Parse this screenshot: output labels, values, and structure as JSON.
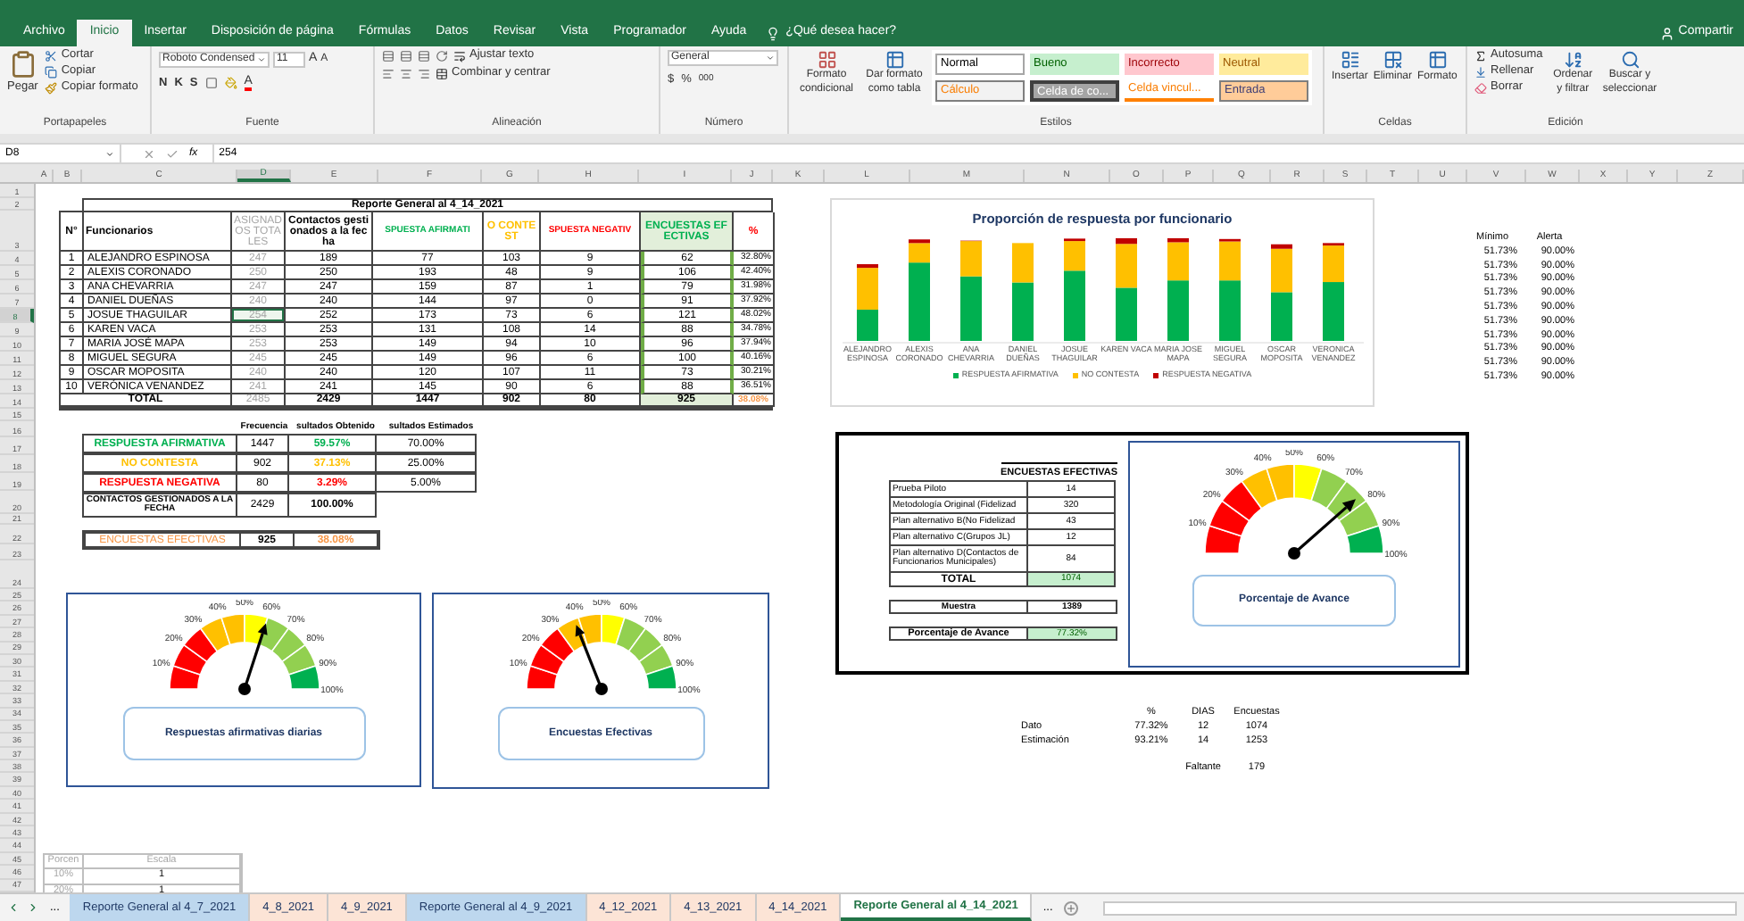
{
  "ribbon": {
    "tabs": [
      {
        "label": "Archivo",
        "selected": false
      },
      {
        "label": "Inicio",
        "selected": true
      },
      {
        "label": "Insertar",
        "selected": false
      },
      {
        "label": "Disposición de página",
        "selected": false
      },
      {
        "label": "Fórmulas",
        "selected": false
      },
      {
        "label": "Datos",
        "selected": false
      },
      {
        "label": "Revisar",
        "selected": false
      },
      {
        "label": "Vista",
        "selected": false
      },
      {
        "label": "Programador",
        "selected": false
      },
      {
        "label": "Ayuda",
        "selected": false
      }
    ],
    "tell_me": "¿Qué desea hacer?",
    "share": "Compartir",
    "clipboard": {
      "paste": "Pegar",
      "cut": "Cortar",
      "copy": "Copiar",
      "format_painter": "Copiar formato",
      "label": "Portapapeles"
    },
    "font": {
      "name": "Roboto Condensed",
      "size": "11",
      "grow": "A",
      "shrink": "A",
      "styles": [
        "N",
        "K",
        "S"
      ],
      "font_color_label": "A",
      "label": "Fuente"
    },
    "alignment": {
      "wrap": "Ajustar texto",
      "merge": "Combinar y centrar",
      "label": "Alineación"
    },
    "number": {
      "format": "General",
      "currency": "$",
      "percent": "%",
      "thousands": "000",
      "label": "Número"
    },
    "styles": {
      "conditional": "Formato condicional",
      "as_table": "Dar formato como tabla",
      "label": "Estilos",
      "gallery": [
        {
          "label": "Normal",
          "kind": "normal"
        },
        {
          "label": "Bueno",
          "kind": "good"
        },
        {
          "label": "Incorrecto",
          "kind": "bad"
        },
        {
          "label": "Neutral",
          "kind": "neutral"
        },
        {
          "label": "Cálculo",
          "kind": "calc"
        },
        {
          "label": "Celda de co...",
          "kind": "check"
        },
        {
          "label": "Celda vincul...",
          "kind": "linked"
        },
        {
          "label": "Entrada",
          "kind": "input"
        }
      ]
    },
    "cells": {
      "buttons": [
        "Insertar",
        "Eliminar",
        "Formato"
      ],
      "label": "Celdas"
    },
    "editing": {
      "autosum": "Autosuma",
      "fill": "Rellenar",
      "clear": "Borrar",
      "sort": "Ordenar y filtrar",
      "find": "Buscar y seleccionar",
      "label": "Edición"
    }
  },
  "formula_bar": {
    "name_box": "D8",
    "fx": "fx",
    "formula": "254"
  },
  "columns": [
    {
      "label": "A",
      "selected": false
    },
    {
      "label": "B",
      "selected": false
    },
    {
      "label": "C",
      "selected": false
    },
    {
      "label": "D",
      "selected": true
    },
    {
      "label": "E",
      "selected": false
    },
    {
      "label": "F",
      "selected": false
    },
    {
      "label": "G",
      "selected": false
    },
    {
      "label": "H",
      "selected": false
    },
    {
      "label": "I",
      "selected": false
    },
    {
      "label": "J",
      "selected": false
    },
    {
      "label": "K",
      "selected": false
    },
    {
      "label": "L",
      "selected": false
    },
    {
      "label": "M",
      "selected": false
    },
    {
      "label": "N",
      "selected": false
    },
    {
      "label": "O",
      "selected": false
    },
    {
      "label": "P",
      "selected": false
    },
    {
      "label": "Q",
      "selected": false
    },
    {
      "label": "R",
      "selected": false
    },
    {
      "label": "S",
      "selected": false
    },
    {
      "label": "T",
      "selected": false
    },
    {
      "label": "U",
      "selected": false
    },
    {
      "label": "V",
      "selected": false
    },
    {
      "label": "W",
      "selected": false
    },
    {
      "label": "X",
      "selected": false
    },
    {
      "label": "Y",
      "selected": false
    },
    {
      "label": "Z",
      "selected": false
    }
  ],
  "rows": [
    {
      "label": "1",
      "selected": false
    },
    {
      "label": "2",
      "selected": false
    },
    {
      "label": "3",
      "selected": false
    },
    {
      "label": "4",
      "selected": false
    },
    {
      "label": "5",
      "selected": false
    },
    {
      "label": "6",
      "selected": false
    },
    {
      "label": "7",
      "selected": false
    },
    {
      "label": "8",
      "selected": true
    },
    {
      "label": "9",
      "selected": false
    },
    {
      "label": "10",
      "selected": false
    },
    {
      "label": "11",
      "selected": false
    },
    {
      "label": "12",
      "selected": false
    },
    {
      "label": "13",
      "selected": false
    },
    {
      "label": "14",
      "selected": false
    },
    {
      "label": "15",
      "selected": false
    },
    {
      "label": "16",
      "selected": false
    },
    {
      "label": "17",
      "selected": false
    },
    {
      "label": "18",
      "selected": false
    },
    {
      "label": "19",
      "selected": false
    },
    {
      "label": "20",
      "selected": false
    },
    {
      "label": "21",
      "selected": false
    },
    {
      "label": "22",
      "selected": false
    },
    {
      "label": "23",
      "selected": false
    },
    {
      "label": "24",
      "selected": false
    },
    {
      "label": "25",
      "selected": false
    },
    {
      "label": "26",
      "selected": false
    },
    {
      "label": "27",
      "selected": false
    },
    {
      "label": "28",
      "selected": false
    },
    {
      "label": "29",
      "selected": false
    },
    {
      "label": "30",
      "selected": false
    },
    {
      "label": "31",
      "selected": false
    },
    {
      "label": "32",
      "selected": false
    },
    {
      "label": "33",
      "selected": false
    },
    {
      "label": "34",
      "selected": false
    },
    {
      "label": "35",
      "selected": false
    },
    {
      "label": "36",
      "selected": false
    },
    {
      "label": "37",
      "selected": false
    },
    {
      "label": "38",
      "selected": false
    },
    {
      "label": "39",
      "selected": false
    },
    {
      "label": "40",
      "selected": false
    },
    {
      "label": "41",
      "selected": false
    },
    {
      "label": "42",
      "selected": false
    },
    {
      "label": "43",
      "selected": false
    },
    {
      "label": "44",
      "selected": false
    },
    {
      "label": "45",
      "selected": false
    },
    {
      "label": "46",
      "selected": false
    },
    {
      "label": "47",
      "selected": false
    }
  ],
  "report": {
    "title": "Reporte General al 4_14_2021",
    "headers": [
      {
        "label": "N°",
        "kind": "plain"
      },
      {
        "label": "Funcionarios",
        "kind": "plain"
      },
      {
        "label": "ASIGNADOS TOTALES",
        "kind": "assigned"
      },
      {
        "label": "Contactos gestionados a la fecha",
        "kind": "plain"
      },
      {
        "label": "SPUESTA AFIRMATI",
        "kind": "affirmative"
      },
      {
        "label": "O CONTEST",
        "kind": "no_answer"
      },
      {
        "label": "SPUESTA NEGATIV",
        "kind": "negative"
      },
      {
        "label": "ENCUESTAS EFECTIVAS",
        "kind": "effective"
      },
      {
        "label": "%",
        "kind": "pct"
      }
    ],
    "rows": [
      {
        "n": "1",
        "name": "ALEJANDRO ESPINOSA",
        "assigned": "247",
        "contacts": "189",
        "yes": "77",
        "no_answer": "103",
        "no": "9",
        "effective": "62",
        "pct": "32.80%",
        "active": false
      },
      {
        "n": "2",
        "name": "ALEXIS CORONADO",
        "assigned": "250",
        "contacts": "250",
        "yes": "193",
        "no_answer": "48",
        "no": "9",
        "effective": "106",
        "pct": "42.40%",
        "active": false
      },
      {
        "n": "3",
        "name": "ANA CHEVARRIA",
        "assigned": "247",
        "contacts": "247",
        "yes": "159",
        "no_answer": "87",
        "no": "1",
        "effective": "79",
        "pct": "31.98%",
        "active": false
      },
      {
        "n": "4",
        "name": "DANIEL DUEÑAS",
        "assigned": "240",
        "contacts": "240",
        "yes": "144",
        "no_answer": "97",
        "no": "0",
        "effective": "91",
        "pct": "37.92%",
        "active": false
      },
      {
        "n": "5",
        "name": "JOSUE THAGUILAR",
        "assigned": "254",
        "contacts": "252",
        "yes": "173",
        "no_answer": "73",
        "no": "6",
        "effective": "121",
        "pct": "48.02%",
        "active": true
      },
      {
        "n": "6",
        "name": "KAREN VACA",
        "assigned": "253",
        "contacts": "253",
        "yes": "131",
        "no_answer": "108",
        "no": "14",
        "effective": "88",
        "pct": "34.78%",
        "active": false
      },
      {
        "n": "7",
        "name": "MARIA JOSÉ MAPA",
        "assigned": "253",
        "contacts": "253",
        "yes": "149",
        "no_answer": "94",
        "no": "10",
        "effective": "96",
        "pct": "37.94%",
        "active": false
      },
      {
        "n": "8",
        "name": "MIGUEL SEGURA",
        "assigned": "245",
        "contacts": "245",
        "yes": "149",
        "no_answer": "96",
        "no": "6",
        "effective": "100",
        "pct": "40.16%",
        "active": false
      },
      {
        "n": "9",
        "name": "OSCAR MOPOSITA",
        "assigned": "240",
        "contacts": "240",
        "yes": "120",
        "no_answer": "107",
        "no": "11",
        "effective": "73",
        "pct": "30.21%",
        "active": false
      },
      {
        "n": "10",
        "name": "VERÓNICA VENANDEZ",
        "assigned": "241",
        "contacts": "241",
        "yes": "145",
        "no_answer": "90",
        "no": "6",
        "effective": "88",
        "pct": "36.51%",
        "active": false
      }
    ],
    "total": {
      "label": "TOTAL",
      "assigned": "2485",
      "contacts": "2429",
      "yes": "1447",
      "no_answer": "902",
      "no": "80",
      "effective": "925",
      "pct": "38.08%"
    }
  },
  "chart": {
    "title": "Proporción de respuesta por funcionario",
    "categories": [
      "ALEJANDRO ESPINOSA",
      "ALEXIS CORONADO",
      "ANA CHEVARRIA",
      "DANIEL DUEÑAS",
      "JOSUE THAGUILAR",
      "KAREN VACA",
      "MARIA JOSE MAPA",
      "MIGUEL SEGURA",
      "OSCAR MOPOSITA",
      "VERONICA VENANDEZ"
    ],
    "legend": [
      {
        "label": "RESPUESTA AFIRMATIVA",
        "color": "#00b050"
      },
      {
        "label": "NO CONTESTA",
        "color": "#ffc000"
      },
      {
        "label": "RESPUESTA NEGATIVA",
        "color": "#c00000"
      }
    ]
  },
  "thresholds": {
    "headers": [
      "Mínimo",
      "Alerta"
    ],
    "rows": [
      [
        "51.73%",
        "90.00%"
      ],
      [
        "51.73%",
        "90.00%"
      ],
      [
        "51.73%",
        "90.00%"
      ],
      [
        "51.73%",
        "90.00%"
      ],
      [
        "51.73%",
        "90.00%"
      ],
      [
        "51.73%",
        "90.00%"
      ],
      [
        "51.73%",
        "90.00%"
      ],
      [
        "51.73%",
        "90.00%"
      ],
      [
        "51.73%",
        "90.00%"
      ],
      [
        "51.73%",
        "90.00%"
      ]
    ]
  },
  "frequency": {
    "headers": [
      "Frecuencia",
      "sultados Obtenido",
      "sultados Estimados"
    ],
    "rows": [
      {
        "label": "RESPUESTA AFIRMATIVA",
        "kind": "affirmative",
        "count": "1447",
        "obtained": "59.57%",
        "estimated": "70.00%"
      },
      {
        "label": "NO CONTESTA",
        "kind": "no_answer",
        "count": "902",
        "obtained": "37.13%",
        "estimated": "25.00%"
      },
      {
        "label": "RESPUESTA NEGATIVA",
        "kind": "negative",
        "count": "80",
        "obtained": "3.29%",
        "estimated": "5.00%"
      },
      {
        "label": "CONTACTOS GESTIONADOS A LA FECHA",
        "kind": "contacts",
        "count": "2429",
        "obtained": "100.00%"
      }
    ],
    "effective": {
      "label": "ENCUESTAS EFECTIVAS",
      "count": "925",
      "obtained": "38.08%"
    }
  },
  "gauges": [
    {
      "title": "Respuestas afirmativas diarias",
      "ticks": [
        "10%",
        "20%",
        "30%",
        "40%",
        "50%",
        "60%",
        "70%",
        "80%",
        "90%",
        "100%"
      ]
    },
    {
      "title": "Encuestas Efectivas",
      "ticks": [
        "10%",
        "20%",
        "30%",
        "40%",
        "50%",
        "60%",
        "70%",
        "80%",
        "90%",
        "100%"
      ]
    },
    {
      "title": "Porcentaje de Avance",
      "ticks": [
        "10%",
        "20%",
        "30%",
        "40%",
        "50%",
        "60%",
        "70%",
        "80%",
        "90%",
        "100%"
      ]
    }
  ],
  "progress": {
    "title": "ENCUESTAS EFECTIVAS",
    "rows": [
      {
        "label": "Prueba Piloto",
        "value": "14"
      },
      {
        "label": "Metodología Original (Fidelizad",
        "value": "320"
      },
      {
        "label": "Plan alternativo B(No Fidelizad",
        "value": "43"
      },
      {
        "label": "Plan alternativo C(Grupos JL)",
        "value": "12"
      },
      {
        "label": "Plan alternativo D(Contactos de Funcionarios Municipales)",
        "value": "84"
      }
    ],
    "total": {
      "label": "TOTAL",
      "value": "1074"
    },
    "sample": {
      "label": "Muestra",
      "value": "1389"
    },
    "advance": {
      "label": "Porcentaje de Avance",
      "value": "77.32%"
    }
  },
  "estimate": {
    "headers": [
      "%",
      "DIAS",
      "Encuestas"
    ],
    "rows": [
      [
        "Dato",
        "77.32%",
        "12",
        "1074"
      ],
      [
        "Estimación",
        "93.21%",
        "14",
        "1253"
      ]
    ],
    "missing": {
      "label": "Faltante",
      "value": "179"
    }
  },
  "scale": {
    "headers": [
      "Porcen",
      "Escala"
    ],
    "rows": [
      [
        "10%",
        "1"
      ],
      [
        "20%",
        "1"
      ]
    ]
  },
  "sheet_tabs": {
    "more": "...",
    "more_right": "...",
    "tabs": [
      {
        "label": "Reporte General al 4_7_2021",
        "color": "#bdd7ee",
        "selected": false
      },
      {
        "label": "4_8_2021",
        "color": "#fce4d6",
        "selected": false
      },
      {
        "label": "4_9_2021",
        "color": "#fce4d6",
        "selected": false
      },
      {
        "label": "Reporte General al 4_9_2021",
        "color": "#bdd7ee",
        "selected": false
      },
      {
        "label": "4_12_2021",
        "color": "#fce4d6",
        "selected": false
      },
      {
        "label": "4_13_2021",
        "color": "#fce4d6",
        "selected": false
      },
      {
        "label": "4_14_2021",
        "color": "#fce4d6",
        "selected": false
      },
      {
        "label": "Reporte General al 4_14_2021",
        "color": "#ffffff",
        "selected": true
      }
    ]
  }
}
